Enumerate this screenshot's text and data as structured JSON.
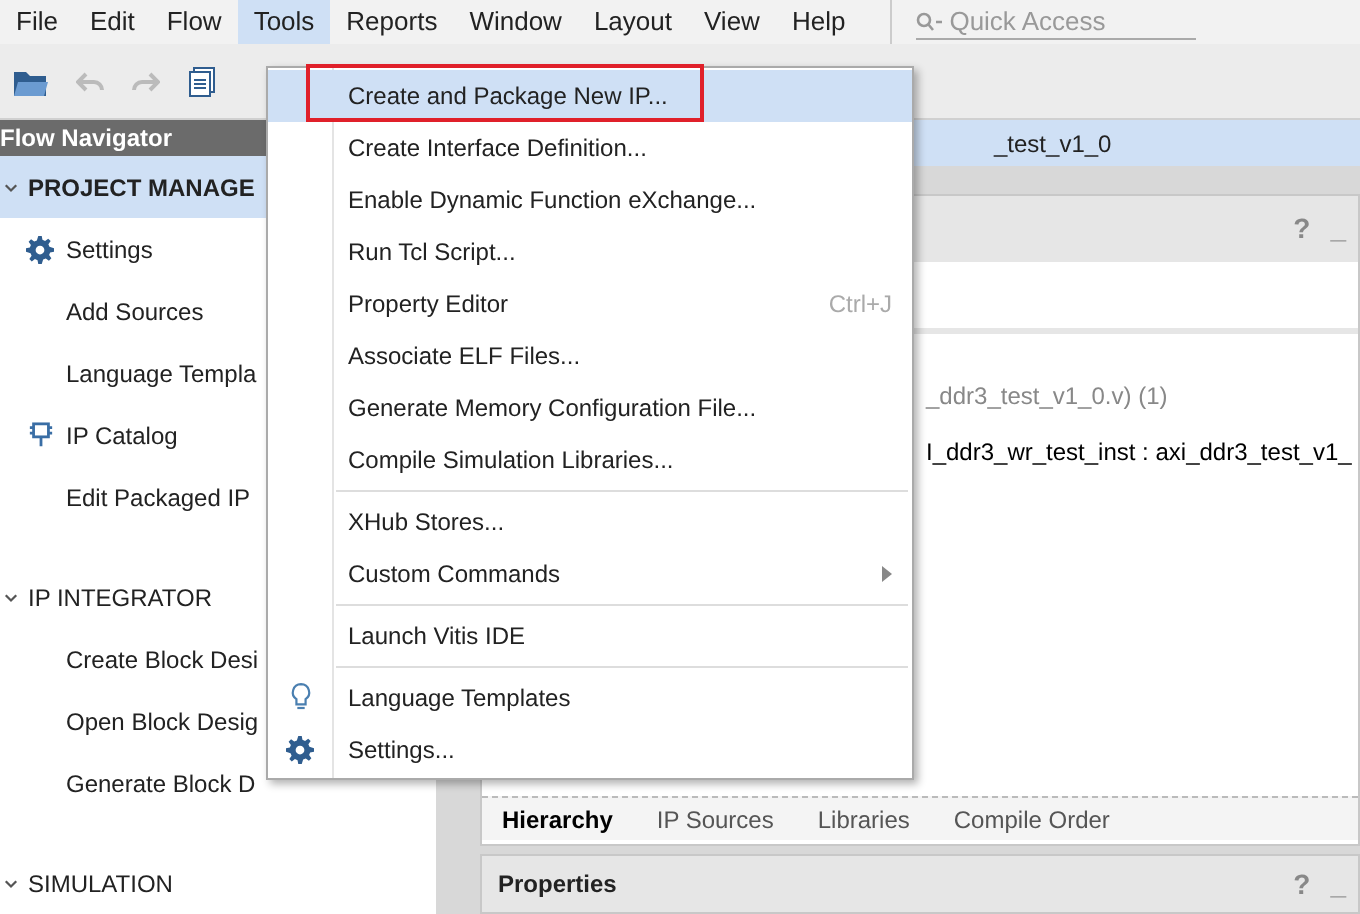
{
  "menu_bar": [
    {
      "label": "File",
      "selected": false
    },
    {
      "label": "Edit",
      "selected": false
    },
    {
      "label": "Flow",
      "selected": false
    },
    {
      "label": "Tools",
      "selected": true
    },
    {
      "label": "Reports",
      "selected": false
    },
    {
      "label": "Window",
      "selected": false
    },
    {
      "label": "Layout",
      "selected": false
    },
    {
      "label": "View",
      "selected": false
    },
    {
      "label": "Help",
      "selected": false
    }
  ],
  "quick_access": {
    "placeholder": "Quick Access"
  },
  "flow_navigator": {
    "title": "Flow Navigator",
    "sections": [
      {
        "label": "PROJECT MANAGE",
        "expanded": true,
        "selected": true,
        "children": [
          {
            "label": "Settings",
            "kind": "settings"
          },
          {
            "label": "Add Sources",
            "kind": "plain"
          },
          {
            "label": "Language Templa",
            "kind": "plain"
          },
          {
            "label": "IP Catalog",
            "kind": "catalog"
          },
          {
            "label": "Edit Packaged IP",
            "kind": "plain"
          }
        ]
      },
      {
        "label": "IP INTEGRATOR",
        "expanded": true,
        "selected": false,
        "children": [
          {
            "label": "Create Block Desi",
            "kind": "plain"
          },
          {
            "label": "Open Block Desig",
            "kind": "plain"
          },
          {
            "label": "Generate Block D",
            "kind": "plain"
          }
        ]
      },
      {
        "label": "SIMULATION",
        "expanded": true,
        "selected": false
      }
    ]
  },
  "project_bar": {
    "title": "_test_v1_0"
  },
  "sources": {
    "buttons": [
      "?",
      "_"
    ],
    "lines": [
      {
        "text": "_ddr3_test_v1_0.v) (1)",
        "kind": "file"
      },
      {
        "text": "I_ddr3_wr_test_inst : axi_ddr3_test_v1_",
        "kind": "instance"
      }
    ],
    "tabs": [
      {
        "label": "Hierarchy",
        "selected": true
      },
      {
        "label": "IP Sources",
        "selected": false
      },
      {
        "label": "Libraries",
        "selected": false
      },
      {
        "label": "Compile Order",
        "selected": false
      }
    ]
  },
  "properties": {
    "title": "Properties",
    "buttons": [
      "?",
      "_"
    ]
  },
  "tools_menu": [
    {
      "kind": "item",
      "label": "Create and Package New IP...",
      "selected": true
    },
    {
      "kind": "item",
      "label": "Create Interface Definition...",
      "selected": false
    },
    {
      "kind": "item",
      "label": "Enable Dynamic Function eXchange...",
      "selected": false
    },
    {
      "kind": "item",
      "label": "Run Tcl Script...",
      "selected": false
    },
    {
      "kind": "item",
      "label": "Property Editor",
      "shortcut": "Ctrl+J",
      "selected": false
    },
    {
      "kind": "item",
      "label": "Associate ELF Files...",
      "selected": false
    },
    {
      "kind": "item",
      "label": "Generate Memory Configuration File...",
      "selected": false
    },
    {
      "kind": "item",
      "label": "Compile Simulation Libraries...",
      "selected": false
    },
    {
      "kind": "separator"
    },
    {
      "kind": "item",
      "label": "XHub Stores...",
      "selected": false
    },
    {
      "kind": "item",
      "label": "Custom Commands",
      "submenu": true,
      "selected": false
    },
    {
      "kind": "separator"
    },
    {
      "kind": "item",
      "label": "Launch Vitis IDE",
      "selected": false
    },
    {
      "kind": "separator"
    },
    {
      "kind": "templates",
      "label": "Language Templates",
      "selected": false
    },
    {
      "kind": "settings",
      "label": "Settings...",
      "selected": false
    }
  ]
}
